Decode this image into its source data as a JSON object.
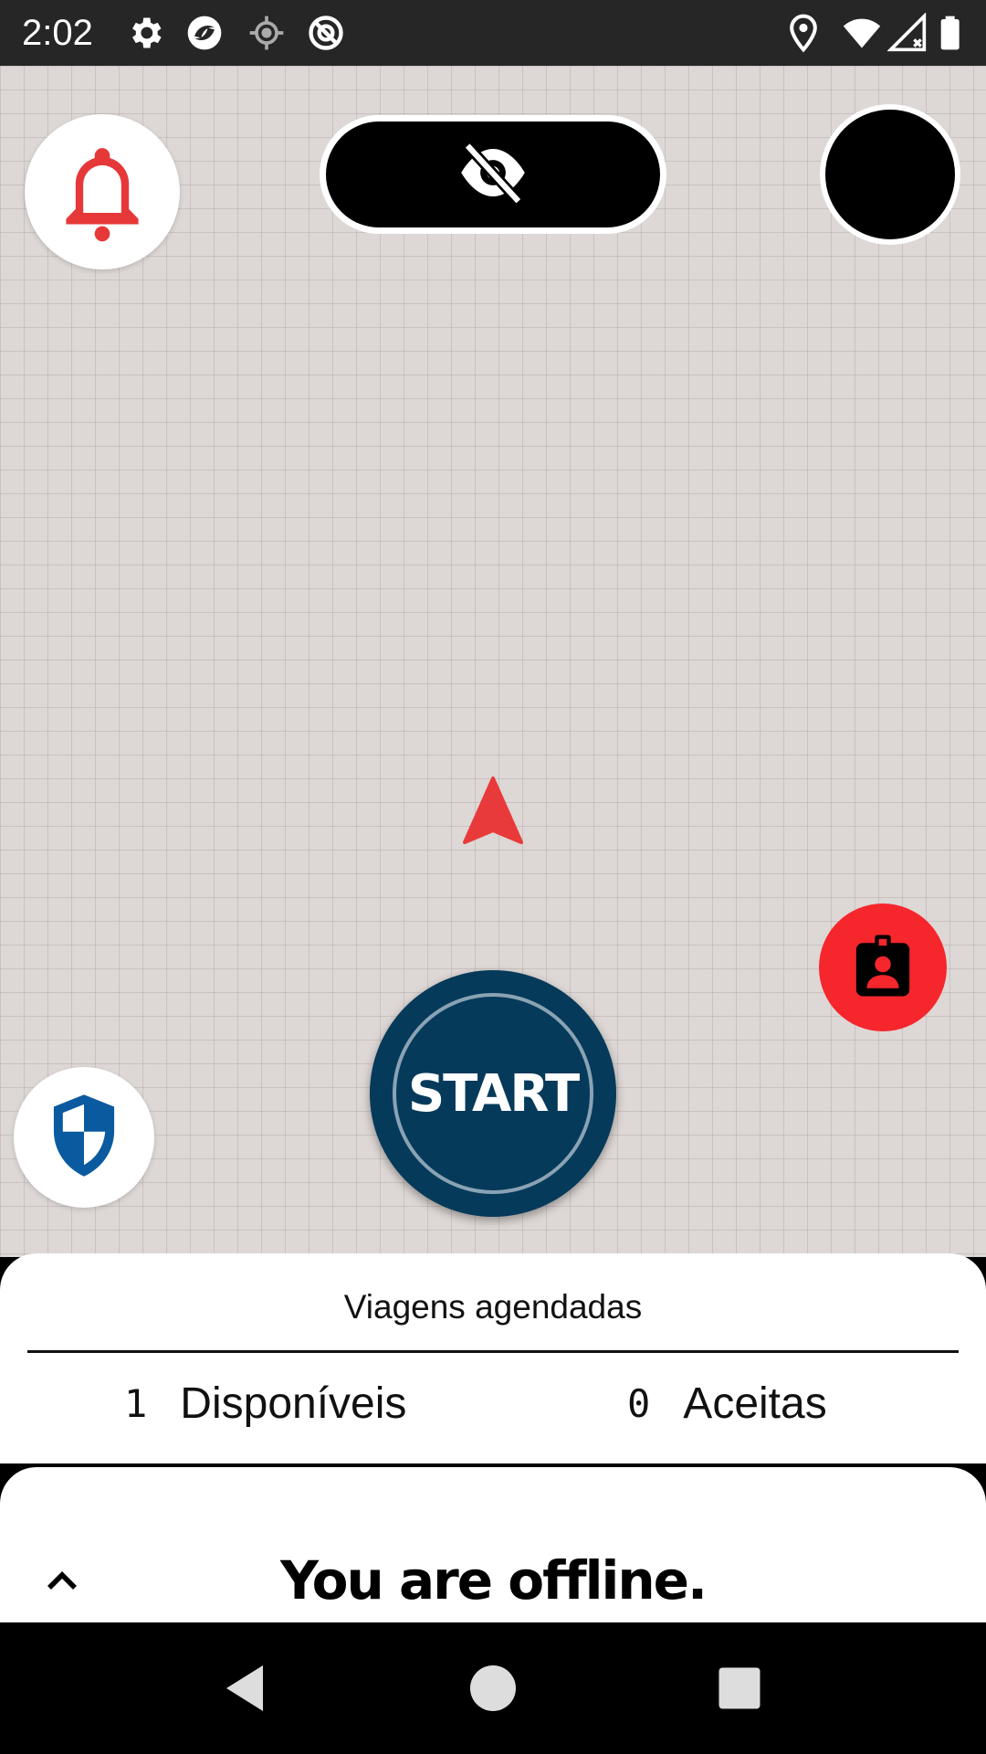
{
  "status_bar": {
    "time": "2:02",
    "left_icons": [
      "settings-icon",
      "app-icon",
      "location-crosshair-icon",
      "no-tracking-icon"
    ],
    "right_icons": [
      "location-pin-icon",
      "wifi-icon",
      "signal-icon",
      "battery-icon"
    ]
  },
  "map": {
    "top_left_button": "bell-icon",
    "top_center_button": "eye-off-icon",
    "top_right_button": "avatar",
    "center_marker": "navigation-arrow-icon",
    "right_button": "driver-badge-icon",
    "left_button": "shield-icon",
    "start_label": "START",
    "colors": {
      "accent_red": "#f5262c",
      "start_blue": "#063a5a",
      "shield_blue": "#0a5aa0"
    }
  },
  "scheduled_trips": {
    "title": "Viagens agendadas",
    "available_count": "1",
    "available_label": "Disponíveis",
    "accepted_count": "0",
    "accepted_label": "Aceitas"
  },
  "status_sheet": {
    "expand_icon": "chevron-up-icon",
    "message": "You are offline."
  },
  "nav_bar": {
    "buttons": [
      "back-icon",
      "home-icon",
      "recents-icon"
    ]
  }
}
